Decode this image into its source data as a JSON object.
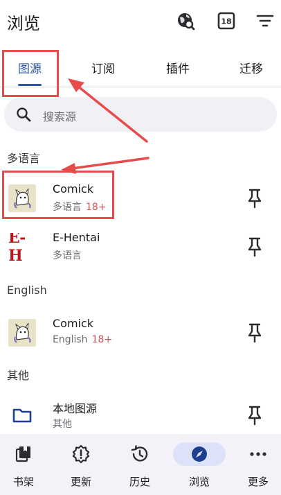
{
  "header": {
    "title": "浏览",
    "icons": [
      "globe-search-icon",
      "nsfw-18-icon",
      "filter-icon"
    ],
    "badge_18": "18"
  },
  "tabs": [
    {
      "label": "图源",
      "active": true
    },
    {
      "label": "订阅",
      "active": false
    },
    {
      "label": "插件",
      "active": false
    },
    {
      "label": "迁移",
      "active": false
    }
  ],
  "search": {
    "placeholder": "搜索源"
  },
  "sections": [
    {
      "title": "多语言",
      "items": [
        {
          "name": "Comick",
          "lang": "多语言",
          "age": "18+",
          "icon": "comick-logo"
        },
        {
          "name": "E-Hentai",
          "lang": "多语言",
          "age": "",
          "icon": "ehentai-logo",
          "logo_text": "E-H"
        }
      ]
    },
    {
      "title": "English",
      "items": [
        {
          "name": "Comick",
          "lang": "English",
          "age": "18+",
          "icon": "comick-logo"
        }
      ]
    },
    {
      "title": "其他",
      "items": [
        {
          "name": "本地图源",
          "lang": "其他",
          "age": "",
          "icon": "folder-icon"
        }
      ]
    }
  ],
  "bottom_nav": [
    {
      "label": "书架",
      "icon": "library-icon",
      "active": false
    },
    {
      "label": "更新",
      "icon": "updates-icon",
      "active": false
    },
    {
      "label": "历史",
      "icon": "history-icon",
      "active": false
    },
    {
      "label": "浏览",
      "icon": "compass-icon",
      "active": true
    },
    {
      "label": "更多",
      "icon": "more-icon",
      "active": false
    }
  ],
  "colors": {
    "accent": "#2f5aa8",
    "annotation": "#e84b4b",
    "age_badge": "#d25656",
    "nav_background": "#f4f1f8",
    "nav_active_pill": "#dce2f7"
  }
}
